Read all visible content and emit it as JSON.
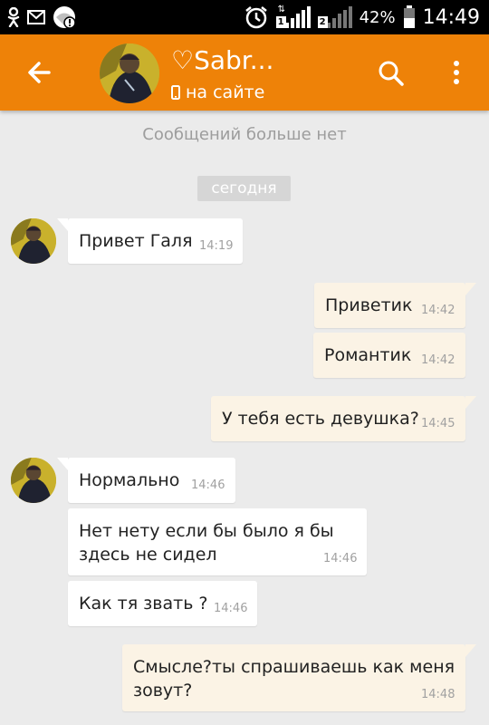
{
  "status_bar": {
    "icons": [
      "odnoklassniki-icon",
      "mail-icon",
      "wifi-warning-icon",
      "alarm-icon",
      "signal-icon",
      "signal-icon",
      "battery-icon"
    ],
    "sim1_label": "1",
    "sim2_label": "2",
    "battery_percent": "42%",
    "battery_level": 0.42,
    "time": "14:49"
  },
  "header": {
    "contact_name": "♡Sabr...",
    "status": "на сайте",
    "accent_color": "#ee8208"
  },
  "chat": {
    "no_more_messages": "Сообщений больше нет",
    "date_divider": "сегодня",
    "messages": [
      {
        "direction": "in",
        "text": "Привет Галя",
        "time": "14:19"
      },
      {
        "direction": "out",
        "text": "Приветик",
        "time": "14:42"
      },
      {
        "direction": "out",
        "text": "Романтик",
        "time": "14:42"
      },
      {
        "direction": "out",
        "text": "У тебя есть девушка?",
        "time": "14:45"
      },
      {
        "direction": "in",
        "text": "Нормально",
        "time": "14:46"
      },
      {
        "direction": "in",
        "text": "Нет нету если бы было я бы здесь не сидел",
        "time": "14:46"
      },
      {
        "direction": "in",
        "text": "Как тя звать ?",
        "time": "14:46"
      },
      {
        "direction": "out",
        "text": "Смысле?ты спрашиваешь как меня зовут?",
        "time": "14:48"
      }
    ]
  }
}
